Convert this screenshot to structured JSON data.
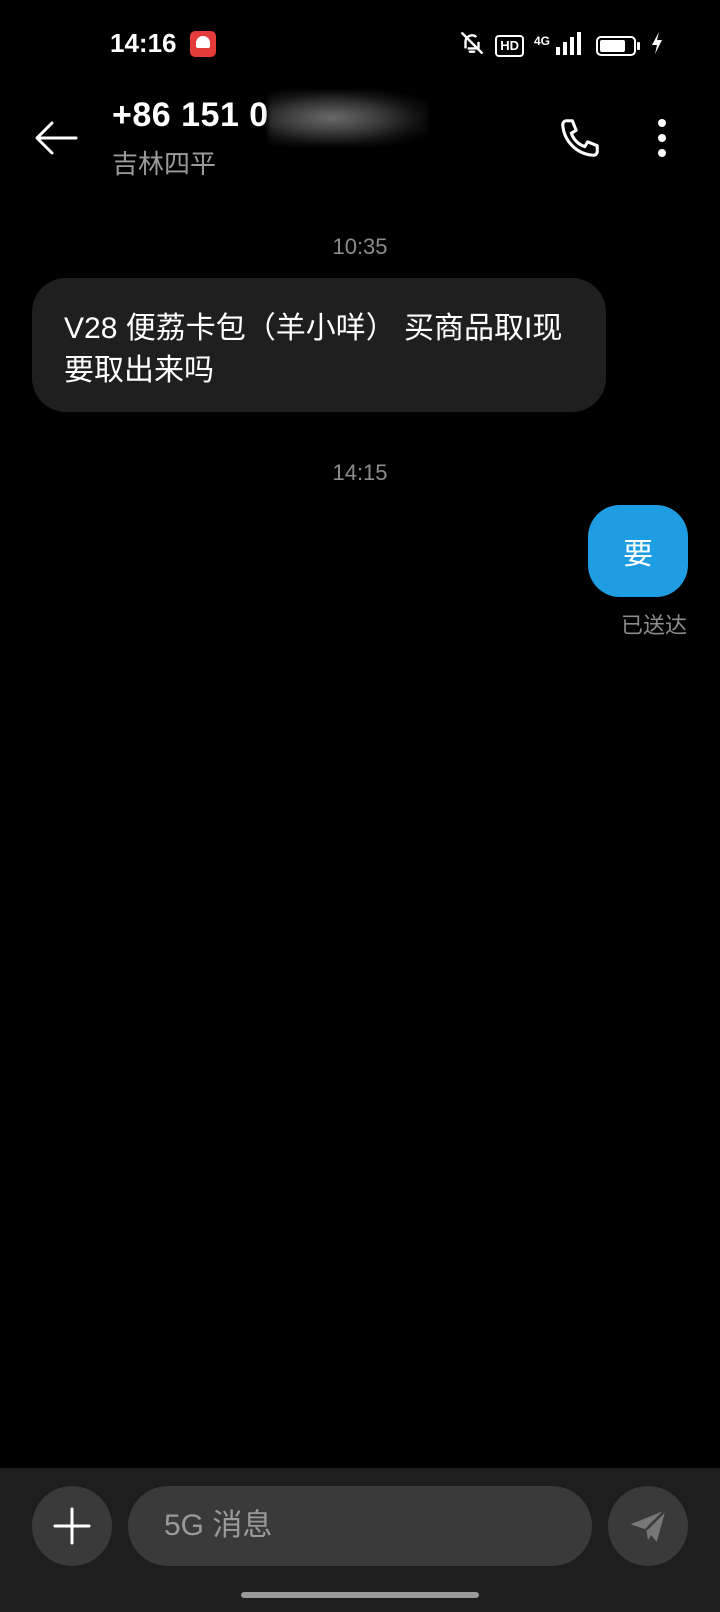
{
  "status_bar": {
    "time": "14:16",
    "hd_label": "HD",
    "network_label": "4G",
    "icons": [
      "app-notification-icon",
      "mute-bell-icon",
      "signal-icon",
      "battery-icon",
      "charging-icon"
    ]
  },
  "header": {
    "contact_number": "+86 151 0",
    "contact_location": "吉林四平",
    "icons": [
      "back-arrow-icon",
      "phone-icon",
      "more-vertical-icon"
    ]
  },
  "messages": [
    {
      "timestamp": "10:35",
      "direction": "incoming",
      "text": "V28 便荔卡包（羊小咩） 买商品取I现  要取出来吗"
    },
    {
      "timestamp": "14:15",
      "direction": "outgoing",
      "text": "要",
      "status": "已送达"
    }
  ],
  "composer": {
    "placeholder": "5G 消息",
    "value": "",
    "icons": [
      "plus-icon",
      "send-icon"
    ]
  },
  "colors": {
    "background": "#000000",
    "incoming_bubble": "#1f1f1f",
    "outgoing_bubble": "#1e9de3",
    "secondary_text": "#8c8c8c",
    "input_bar": "#1e1e1e"
  }
}
